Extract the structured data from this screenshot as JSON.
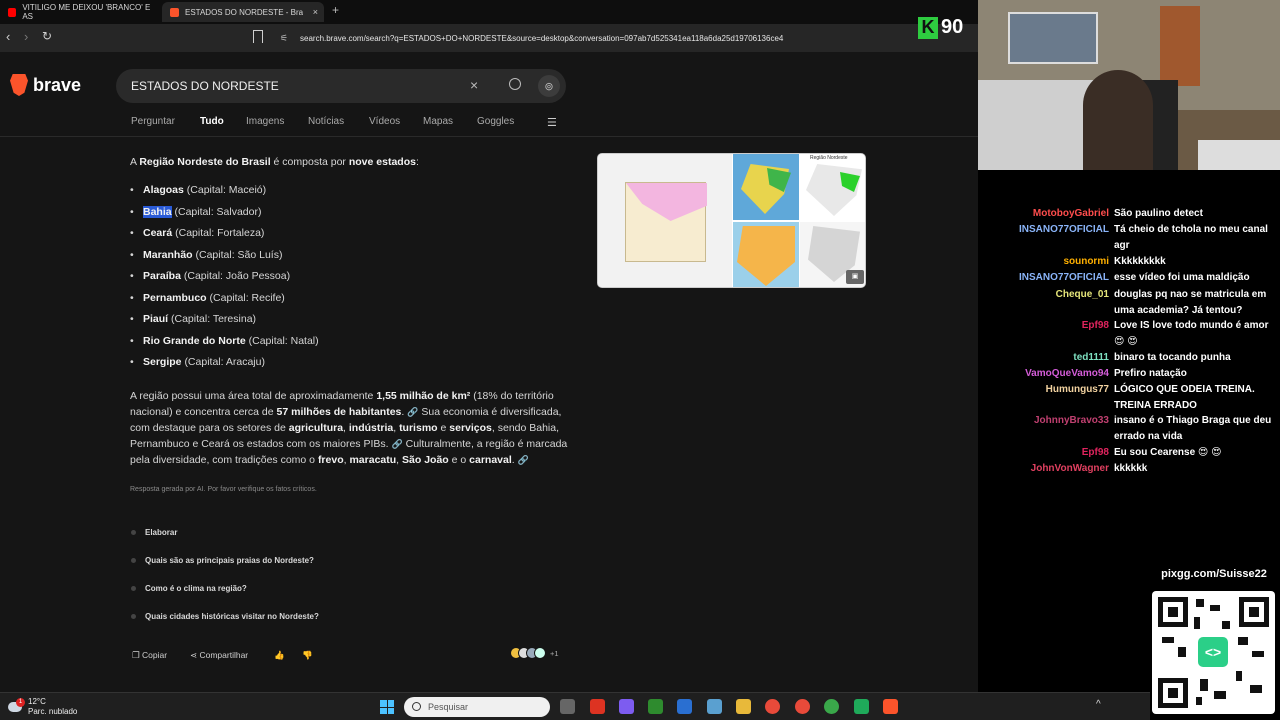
{
  "tabs": [
    {
      "label": "VITILIGO ME DEIXOU 'BRANCO' E AS",
      "favicon_color": "#ff0000"
    },
    {
      "label": "ESTADOS DO NORDESTE - Brave",
      "favicon_color": "#fb542b",
      "close": "×"
    }
  ],
  "new_tab": "+",
  "url": "search.brave.com/search?q=ESTADOS+DO+NORDESTE&source=desktop&conversation=097ab7d525341ea118a6da25d19706136ce4",
  "overlay_logo": {
    "letter": "K",
    "number": "90"
  },
  "brand": {
    "name": "brave"
  },
  "search": {
    "query": "ESTADOS DO NORDESTE",
    "clear": "×",
    "ai_icon": "⊚"
  },
  "nav_tabs": [
    "Perguntar",
    "Tudo",
    "Imagens",
    "Notícias",
    "Vídeos",
    "Mapas",
    "Goggles"
  ],
  "nav_active": "Tudo",
  "answer": {
    "intro": {
      "a": "A ",
      "b": "Região Nordeste do Brasil",
      "c": " é composta por ",
      "d": "nove estados",
      "e": ":"
    },
    "states": [
      {
        "name": "Alagoas",
        "capital": "(Capital: Maceió)"
      },
      {
        "name": "Bahia",
        "capital": "(Capital: Salvador)"
      },
      {
        "name": "Ceará",
        "capital": "(Capital: Fortaleza)"
      },
      {
        "name": "Maranhão",
        "capital": "(Capital: São Luís)"
      },
      {
        "name": "Paraíba",
        "capital": "(Capital: João Pessoa)"
      },
      {
        "name": "Pernambuco",
        "capital": "(Capital: Recife)"
      },
      {
        "name": "Piauí",
        "capital": "(Capital: Teresina)"
      },
      {
        "name": "Rio Grande do Norte",
        "capital": "(Capital: Natal)"
      },
      {
        "name": "Sergipe",
        "capital": "(Capital: Aracaju)"
      }
    ],
    "para": {
      "t1": "A região possui uma área total de aproximadamente ",
      "b1": "1,55 milhão de km²",
      "t2": " (18% do território nacional) e concentra cerca de ",
      "b2": "57 milhões de habitantes",
      "t3": ". ",
      "t4": " Sua economia é diversificada, com destaque para os setores de ",
      "b3": "agricultura",
      "t5": ", ",
      "b4": "indústria",
      "t6": ", ",
      "b5": "turismo",
      "t7": " e ",
      "b6": "serviços",
      "t8": ", sendo Bahia, Pernambuco e Ceará os estados com os maiores PIBs. ",
      "t9": " Culturalmente, a região é marcada pela diversidade, com tradições como o ",
      "b7": "frevo",
      "t10": ", ",
      "b8": "maracatu",
      "t11": ", ",
      "b9": "São João",
      "t12": " e o ",
      "b10": "carnaval",
      "t13": ". "
    },
    "link_glyph": "🔗",
    "disclaimer": "Resposta gerada por AI. Por favor verifique os fatos críticos."
  },
  "chips": [
    "Elaborar",
    "Quais são as principais praias do Nordeste?",
    "Como é o clima na região?",
    "Quais cidades históricas visitar no Nordeste?"
  ],
  "actions": {
    "copy": "Copiar",
    "share": "Compartilhar",
    "like": "👍",
    "dislike": "👎",
    "sources_more": "+1"
  },
  "maps": {
    "thumb_title": "Região Nordeste"
  },
  "chat": [
    {
      "user": "MotoboyGabriel",
      "color": "#ff4d4d",
      "text": "São paulino detect"
    },
    {
      "user": "INSANO77OFICIAL",
      "color": "#8ab4f8",
      "text": "Tá cheio de tchola no meu canal agr"
    },
    {
      "user": "sounormi",
      "color": "#ffb000",
      "text": "Kkkkkkkkk"
    },
    {
      "user": "INSANO77OFICIAL",
      "color": "#8ab4f8",
      "text": "esse vídeo foi uma maldição"
    },
    {
      "user": "Cheque_01",
      "color": "#e6e67a",
      "text": "douglas pq nao se matricula em uma academia? Já tentou?"
    },
    {
      "user": "Epf98",
      "color": "#e0245e",
      "text": "Love IS love todo mundo é amor 😍 😍"
    },
    {
      "user": "ted1111",
      "color": "#7ee0c0",
      "text": "binaro ta tocando punha"
    },
    {
      "user": "VamoQueVamo94",
      "color": "#d45dd8",
      "text": "Prefiro natação"
    },
    {
      "user": "Humungus77",
      "color": "#f2d2a0",
      "text": "LÓGICO QUE ODEIA TREINA. TREINA ERRADO"
    },
    {
      "user": "JohnnyBravo33",
      "color": "#c04070",
      "text": "insano é o Thiago Braga que deu errado na vida"
    },
    {
      "user": "Epf98",
      "color": "#e0245e",
      "text": "Eu sou Cearense 😍 😍"
    },
    {
      "user": "JohnVonWagner",
      "color": "#e04060",
      "text": "kkkkkk"
    }
  ],
  "qr": {
    "label": "pixgg.com/Suisse22",
    "center": "<>"
  },
  "taskbar": {
    "weather_temp": "12°C",
    "weather_desc": "Parc. nublado",
    "weather_badge": "1",
    "search_placeholder": "Pesquisar",
    "tray": "^"
  }
}
